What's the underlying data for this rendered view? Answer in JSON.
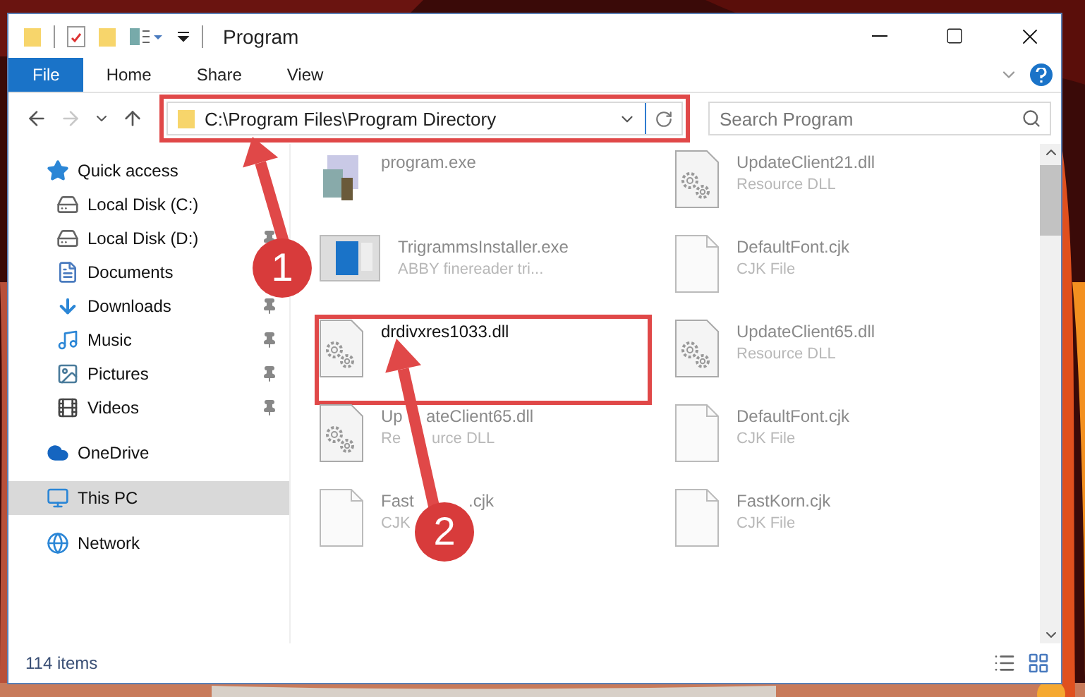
{
  "window": {
    "title": "Program"
  },
  "ribbon_tabs": [
    {
      "label": "File",
      "kind": "menu"
    },
    {
      "label": "Home",
      "kind": "tab"
    },
    {
      "label": "Share",
      "kind": "tab"
    },
    {
      "label": "View",
      "kind": "tab"
    }
  ],
  "address": {
    "path": "C:\\Program Files\\Program Directory"
  },
  "search": {
    "placeholder": "Search Program"
  },
  "nav": [
    {
      "label": "Quick access",
      "kind": "star",
      "pinned": false,
      "selected": false
    },
    {
      "label": "Local Disk (C:)",
      "kind": "drive",
      "pinned": false,
      "selected": false
    },
    {
      "label": "Local Disk (D:)",
      "kind": "drive",
      "pinned": true,
      "selected": false
    },
    {
      "label": "Documents",
      "kind": "docs",
      "pinned": false,
      "selected": false
    },
    {
      "label": "Downloads",
      "kind": "download",
      "pinned": true,
      "selected": false
    },
    {
      "label": "Music",
      "kind": "music",
      "pinned": true,
      "selected": false
    },
    {
      "label": "Pictures",
      "kind": "pictures",
      "pinned": true,
      "selected": false
    },
    {
      "label": "Videos",
      "kind": "videos",
      "pinned": true,
      "selected": false
    },
    {
      "label": "OneDrive",
      "kind": "cloud",
      "pinned": false,
      "selected": false
    },
    {
      "label": "This PC",
      "kind": "pc",
      "pinned": false,
      "selected": true
    },
    {
      "label": "Network",
      "kind": "network",
      "pinned": false,
      "selected": false
    }
  ],
  "files": [
    {
      "name": "program.exe",
      "kind": "exe",
      "focus": false
    },
    {
      "name": "UpdateClient21.dll",
      "type": "Resource DLL",
      "kind": "dll",
      "focus": false
    },
    {
      "name": "TrigrammsInstaller.exe",
      "type": "ABBY finereader tri...",
      "kind": "installer",
      "focus": false
    },
    {
      "name": "DefaultFont.cjk",
      "type": "CJK File",
      "kind": "blank",
      "focus": false
    },
    {
      "name": "drdivxres1033.dll",
      "kind": "dll",
      "focus": true
    },
    {
      "name": "UpdateClient65.dll",
      "type": "Resource DLL",
      "kind": "dll",
      "focus": false
    },
    {
      "name_parts": [
        "Up",
        "ateClient65.dll"
      ],
      "type_parts": [
        "Re",
        "urce DLL"
      ],
      "kind": "dll",
      "focus": false
    },
    {
      "name": "DefaultFont.cjk",
      "type": "CJK File",
      "kind": "blank",
      "focus": false
    },
    {
      "name_parts": [
        "Fast",
        ".cjk"
      ],
      "type": "CJK",
      "kind": "blank",
      "focus": false
    },
    {
      "name": "FastKorn.cjk",
      "type": "CJK File",
      "kind": "blank",
      "focus": false
    }
  ],
  "status_bar": {
    "item_count": "114 items"
  },
  "annotations": [
    {
      "number": "1"
    },
    {
      "number": "2"
    }
  ]
}
